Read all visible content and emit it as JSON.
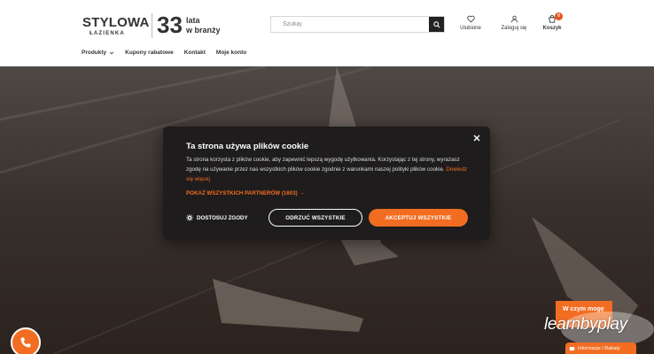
{
  "header": {
    "logo": {
      "brand": "STYLOWA",
      "sub": "ŁAZIENKA",
      "years": "33",
      "years_text_1": "lata",
      "years_text_2": "w branży"
    },
    "search": {
      "placeholder": "Szukaj"
    },
    "favorites_label": "Ulubione",
    "login_label": "Zaloguj się",
    "cart_label": "Koszyk",
    "cart_count": "0"
  },
  "nav": {
    "items": [
      "Produkty",
      "Kupony rabatowe",
      "Kontakt",
      "Moje konto"
    ]
  },
  "cookie": {
    "title": "Ta strona używa plików cookie",
    "body": "Ta strona korzysta z plików cookie, aby zapewnić lepszą wygodę użytkowania. Korzystając z tej strony, wyrażasz zgodę na używanie przez nas wszystkich plików cookie zgodnie z warunkami naszej polityki plików cookie.",
    "more_link": "Dowiedz się więcej",
    "partners": "POKAŻ WSZYSTKICH PARTNERÓW (1603) →",
    "customize": "DOSTOSUJ ZGODY",
    "reject": "ODRZUĆ WSZYSTKIE",
    "accept": "AKCEPTUJ WSZYSTKIE"
  },
  "widgets": {
    "help": "W czym mogę",
    "watermark": "learnbyplay",
    "info": "Informacje / Rabaty"
  },
  "colors": {
    "accent": "#f26d21",
    "modal_bg": "#1e1c1c"
  }
}
